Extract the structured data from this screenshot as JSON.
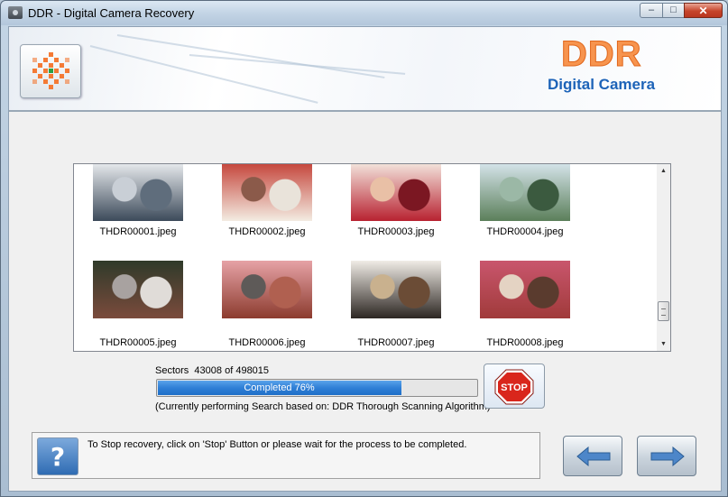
{
  "window": {
    "title": "DDR - Digital Camera Recovery",
    "minimize_glyph": "–",
    "maximize_glyph": "□",
    "close_glyph": "✕"
  },
  "header": {
    "brand": "DDR",
    "product": "Digital Camera",
    "logo_icon": "checker-star-icon"
  },
  "gallery": {
    "items": [
      {
        "name": "THDR00001.jpeg",
        "palette": [
          "#3c4a5a",
          "#c9cfd6",
          "#e7eaed",
          "#5f6d7c"
        ]
      },
      {
        "name": "THDR00002.jpeg",
        "palette": [
          "#f3ece2",
          "#8b5a4a",
          "#c5463c",
          "#e9e3da"
        ]
      },
      {
        "name": "THDR00003.jpeg",
        "palette": [
          "#b82231",
          "#e9c0a6",
          "#f3e4dc",
          "#7b1722"
        ]
      },
      {
        "name": "THDR00004.jpeg",
        "palette": [
          "#5b7f5a",
          "#9bb8a6",
          "#d5e4ea",
          "#3b5a3f"
        ]
      },
      {
        "name": "THDR00005.jpeg",
        "palette": [
          "#7b4b3c",
          "#a8a2a0",
          "#2f3a2a",
          "#e0dcd8"
        ]
      },
      {
        "name": "THDR00006.jpeg",
        "palette": [
          "#8c3b2e",
          "#5e5a58",
          "#e6a2a6",
          "#b06050"
        ]
      },
      {
        "name": "THDR00007.jpeg",
        "palette": [
          "#2c2622",
          "#c9b18e",
          "#f0ece6",
          "#6b4c36"
        ]
      },
      {
        "name": "THDR00008.jpeg",
        "palette": [
          "#a03a3a",
          "#e4d3c3",
          "#c9566d",
          "#5a3b2e"
        ]
      }
    ]
  },
  "scan": {
    "sectors_label": "Sectors",
    "sectors_current": "43008",
    "sectors_of": "of",
    "sectors_total": "498015",
    "progress_label": "Completed 76%",
    "progress_fraction": 0.76,
    "algorithm_text": "(Currently performing Search based on:  DDR Thorough Scanning Algorithm)",
    "stop_label": "STOP"
  },
  "footer": {
    "help_glyph": "?",
    "help_text": "To Stop recovery, click on 'Stop' Button or please wait for the process to be completed."
  },
  "colors": {
    "brand_orange": "#f7944e",
    "brand_blue": "#1d63b8",
    "progress_blue": "#2f7fd6",
    "stop_red": "#d9261c"
  }
}
